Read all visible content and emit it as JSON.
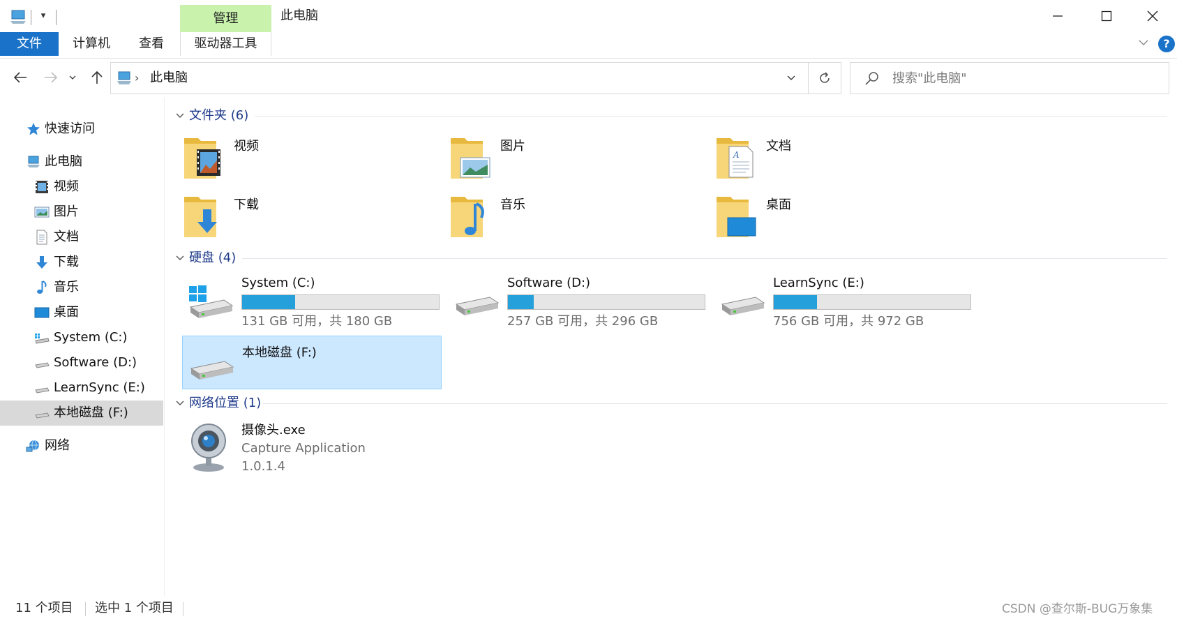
{
  "window": {
    "title": "此电脑",
    "context_tab": "管理",
    "minimize": "minimize",
    "maximize": "maximize",
    "close": "close"
  },
  "ribbon": {
    "tabs": [
      {
        "label": "文件"
      },
      {
        "label": "计算机"
      },
      {
        "label": "查看"
      },
      {
        "label": "驱动器工具"
      }
    ],
    "help": "?"
  },
  "address": {
    "path": "此电脑",
    "search_placeholder": "搜索\"此电脑\""
  },
  "navpane": {
    "items": [
      {
        "label": "快速访问",
        "icon": "star-icon"
      },
      {
        "label": "此电脑",
        "icon": "computer-icon"
      },
      {
        "label": "视频",
        "icon": "video-icon"
      },
      {
        "label": "图片",
        "icon": "picture-icon"
      },
      {
        "label": "文档",
        "icon": "document-icon"
      },
      {
        "label": "下载",
        "icon": "download-icon"
      },
      {
        "label": "音乐",
        "icon": "music-icon"
      },
      {
        "label": "桌面",
        "icon": "desktop-icon"
      },
      {
        "label": "System (C:)",
        "icon": "system-drive-icon"
      },
      {
        "label": "Software (D:)",
        "icon": "drive-icon"
      },
      {
        "label": "LearnSync (E:)",
        "icon": "drive-icon"
      },
      {
        "label": "本地磁盘 (F:)",
        "icon": "drive-icon",
        "selected": true
      },
      {
        "label": "网络",
        "icon": "network-icon"
      }
    ]
  },
  "groups": {
    "folders": {
      "label": "文件夹 (6)",
      "items": [
        {
          "label": "视频",
          "icon": "video-folder-icon"
        },
        {
          "label": "图片",
          "icon": "picture-folder-icon"
        },
        {
          "label": "文档",
          "icon": "document-folder-icon"
        },
        {
          "label": "下载",
          "icon": "download-folder-icon"
        },
        {
          "label": "音乐",
          "icon": "music-folder-icon"
        },
        {
          "label": "桌面",
          "icon": "desktop-folder-icon"
        }
      ]
    },
    "drives": {
      "label": "硬盘 (4)",
      "items": [
        {
          "name": "System (C:)",
          "capacity": "131 GB 可用，共 180 GB",
          "used_fraction": 0.27,
          "icon": "system-drive-icon"
        },
        {
          "name": "Software (D:)",
          "capacity": "257 GB 可用，共 296 GB",
          "used_fraction": 0.13,
          "icon": "drive-icon"
        },
        {
          "name": "LearnSync (E:)",
          "capacity": "756 GB 可用，共 972 GB",
          "used_fraction": 0.22,
          "icon": "drive-icon"
        },
        {
          "name": "本地磁盘 (F:)",
          "capacity": "",
          "icon": "drive-icon",
          "selected": true
        }
      ]
    },
    "network": {
      "label": "网络位置 (1)",
      "items": [
        {
          "name": "摄像头.exe",
          "description": "Capture Application",
          "version": "1.0.1.4",
          "icon": "webcam-icon"
        }
      ]
    }
  },
  "status": {
    "count": "11 个项目",
    "selection": "选中 1 个项目",
    "watermark": "CSDN @查尔斯-BUG万象集"
  },
  "colors": {
    "accent": "#1a73c9",
    "context_tab": "#c9f2ad",
    "group_header": "#1e3a8a",
    "drive_bar": "#26a0da",
    "selection": "#cce8ff",
    "navpane_selection": "#d9d9d9"
  }
}
